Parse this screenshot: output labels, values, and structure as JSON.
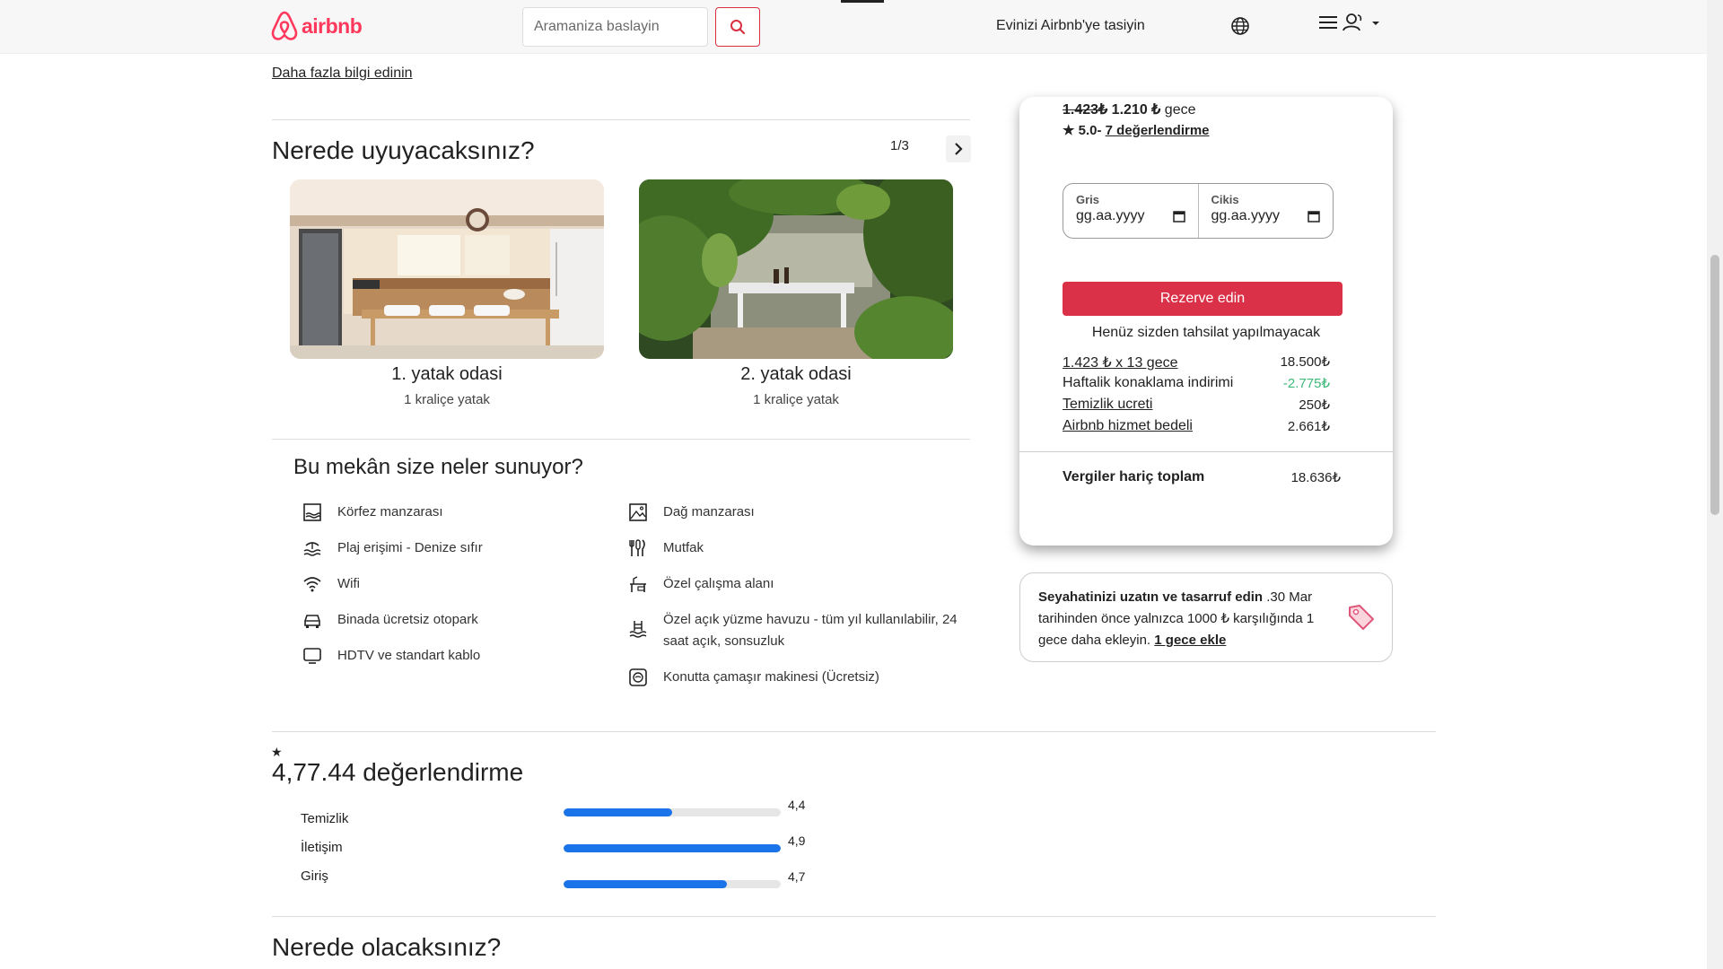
{
  "header": {
    "brand": "airbnb",
    "search_placeholder": "Aramaniza baslayin",
    "host_link": "Evinizi Airbnb'ye tasiyin"
  },
  "listing": {
    "more_info_link": "Daha fazla bilgi edinin",
    "sleep_section": {
      "title": "Nerede uyuyacaksınız?",
      "pager": "1/3",
      "rooms": [
        {
          "title": "1. yatak odasi",
          "bed": "1 kraliçe yatak"
        },
        {
          "title": "2. yatak odasi",
          "bed": "1 kraliçe yatak"
        }
      ]
    },
    "amenities_section": {
      "title": "Bu mekân size neler sunuyor?",
      "left": [
        {
          "icon": "bay-view-icon",
          "label": "Körfez manzarası"
        },
        {
          "icon": "beach-access-icon",
          "label": "Plaj erişimi - Denize sıfır"
        },
        {
          "icon": "wifi-icon",
          "label": "Wifi"
        },
        {
          "icon": "car-icon",
          "label": "Binada ücretsiz otopark"
        },
        {
          "icon": "tv-icon",
          "label": "HDTV ve standart kablo"
        }
      ],
      "right": [
        {
          "icon": "mountain-view-icon",
          "label": "Dağ manzarası"
        },
        {
          "icon": "kitchen-icon",
          "label": "Mutfak"
        },
        {
          "icon": "workspace-icon",
          "label": "Özel çalışma alanı"
        },
        {
          "icon": "pool-icon",
          "label": "Özel açık yüzme havuzu - tüm yıl kullanılabilir, 24 saat açık, sonsuzluk"
        },
        {
          "icon": "washer-icon",
          "label": "Konutta çamaşır makinesi (Ücretsiz)"
        }
      ]
    },
    "reviews": {
      "star": "★",
      "title": "4,77.44 değerlendirme",
      "categories": [
        {
          "label": "Temizlik",
          "value": "4,4",
          "fill": 0.5
        },
        {
          "label": "İletişim",
          "value": "4,9",
          "fill": 1.0
        },
        {
          "label": "Giriş",
          "value": "4,7",
          "fill": 0.75
        }
      ]
    },
    "location_title": "Nerede olacaksınız?"
  },
  "booking": {
    "old_price": "1.423₺",
    "new_price": "1.210 ₺",
    "per_night": "gece",
    "rating": "★ 5.0-",
    "reviews_link": "7 değerlendirme",
    "checkin_label": "Gris",
    "checkout_label": "Cikis",
    "date_placeholder": "gg.aa.yyyy",
    "reserve_button": "Rezerve edin",
    "no_charge_note": "Henüz sizden tahsilat yapılmayacak",
    "fees": [
      {
        "label": "1.423 ₺ x 13 gece",
        "amount": "18.500₺",
        "underline": true
      },
      {
        "label": "Haftalik konaklama indirimi",
        "amount": "-2.775₺",
        "underline": false
      },
      {
        "label": "Temizlik ucreti",
        "amount": "250₺",
        "underline": true
      },
      {
        "label": "Airbnb hizmet bedeli",
        "amount": "2.661₺",
        "underline": true
      }
    ],
    "total_label": "Vergiler hariç toplam",
    "total_amount": "18.636₺"
  },
  "promo": {
    "bold": "Seyahatinizi uzatın ve tasarruf edin",
    "text": ".30 Mar tarihinden önce yalnızca 1000 ₺ karşılığında 1 gece daha ekleyin.",
    "link": "1 gece ekle"
  },
  "colors": {
    "brand": "#ff385c",
    "reserve": "#da3148",
    "discount": "#3cb878",
    "rating_bar": "#1a73e8"
  }
}
